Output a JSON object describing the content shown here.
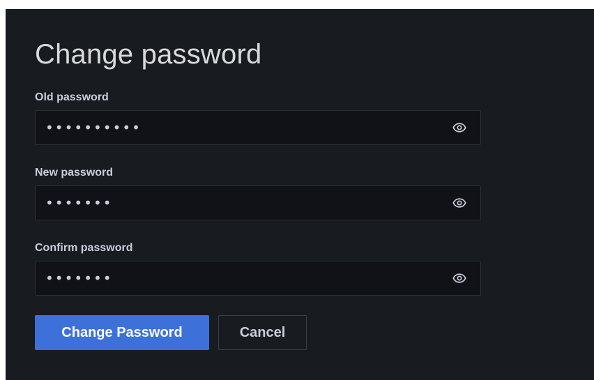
{
  "page": {
    "title": "Change password"
  },
  "form": {
    "fields": [
      {
        "label": "Old password",
        "value": "••••••••••"
      },
      {
        "label": "New password",
        "value": "•••••••"
      },
      {
        "label": "Confirm password",
        "value": "•••••••"
      }
    ],
    "show_password_icon": "eye-icon"
  },
  "actions": {
    "submit_label": "Change Password",
    "cancel_label": "Cancel"
  },
  "colors": {
    "background": "#181b1f",
    "input_background": "#111217",
    "primary": "#3d71d9",
    "text": "#ccccdc"
  }
}
